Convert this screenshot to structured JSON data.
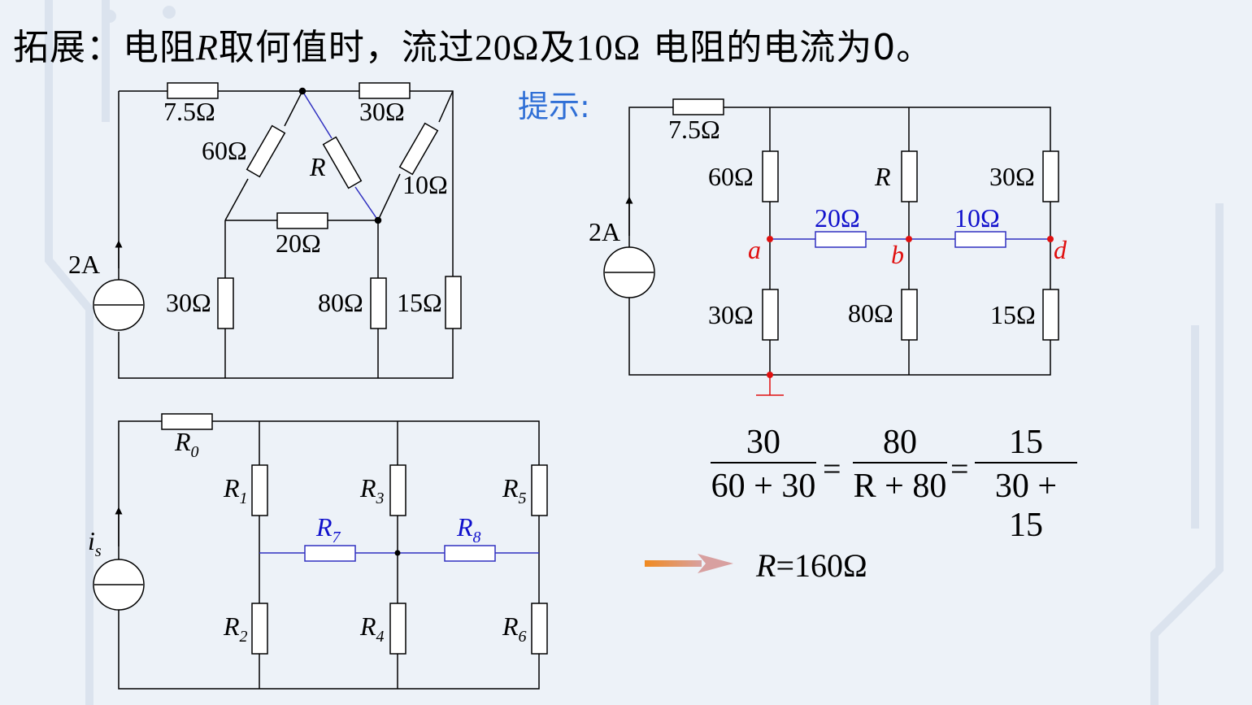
{
  "title": {
    "prefix": "拓展：电阻",
    "r": "R",
    "mid": "取何值时，流过",
    "v1": "20Ω",
    "and": "及",
    "v2": "10Ω",
    "suffix": " 电阻的电流为0。"
  },
  "hint_label": "提示:",
  "circuit1": {
    "source": "2A",
    "labels": [
      "7.5Ω",
      "30Ω",
      "60Ω",
      "R",
      "10Ω",
      "20Ω",
      "30Ω",
      "80Ω",
      "15Ω"
    ]
  },
  "circuit2": {
    "source": "2A",
    "labels": [
      "7.5Ω",
      "60Ω",
      "R",
      "30Ω",
      "20Ω",
      "10Ω",
      "30Ω",
      "80Ω",
      "15Ω"
    ],
    "nodes": [
      "a",
      "b",
      "d"
    ]
  },
  "circuit3": {
    "source": "i",
    "source_sub": "s",
    "resistors": [
      {
        "name": "R",
        "sub": "0"
      },
      {
        "name": "R",
        "sub": "1"
      },
      {
        "name": "R",
        "sub": "3"
      },
      {
        "name": "R",
        "sub": "5"
      },
      {
        "name": "R",
        "sub": "7"
      },
      {
        "name": "R",
        "sub": "8"
      },
      {
        "name": "R",
        "sub": "2"
      },
      {
        "name": "R",
        "sub": "4"
      },
      {
        "name": "R",
        "sub": "6"
      }
    ]
  },
  "equation": {
    "fractions": [
      {
        "num": "30",
        "den": "60 + 30"
      },
      {
        "num": "80",
        "den": "R + 80"
      },
      {
        "num": "15",
        "den": "30 + 15"
      }
    ],
    "eq_sign": "="
  },
  "result": {
    "var": "R",
    "rest": "=160Ω"
  },
  "colors": {
    "hint": "#2f6fd6",
    "node": "#e01010",
    "blue_label": "#1010cc",
    "wire": "#000000",
    "arrow": "#f0a040"
  }
}
